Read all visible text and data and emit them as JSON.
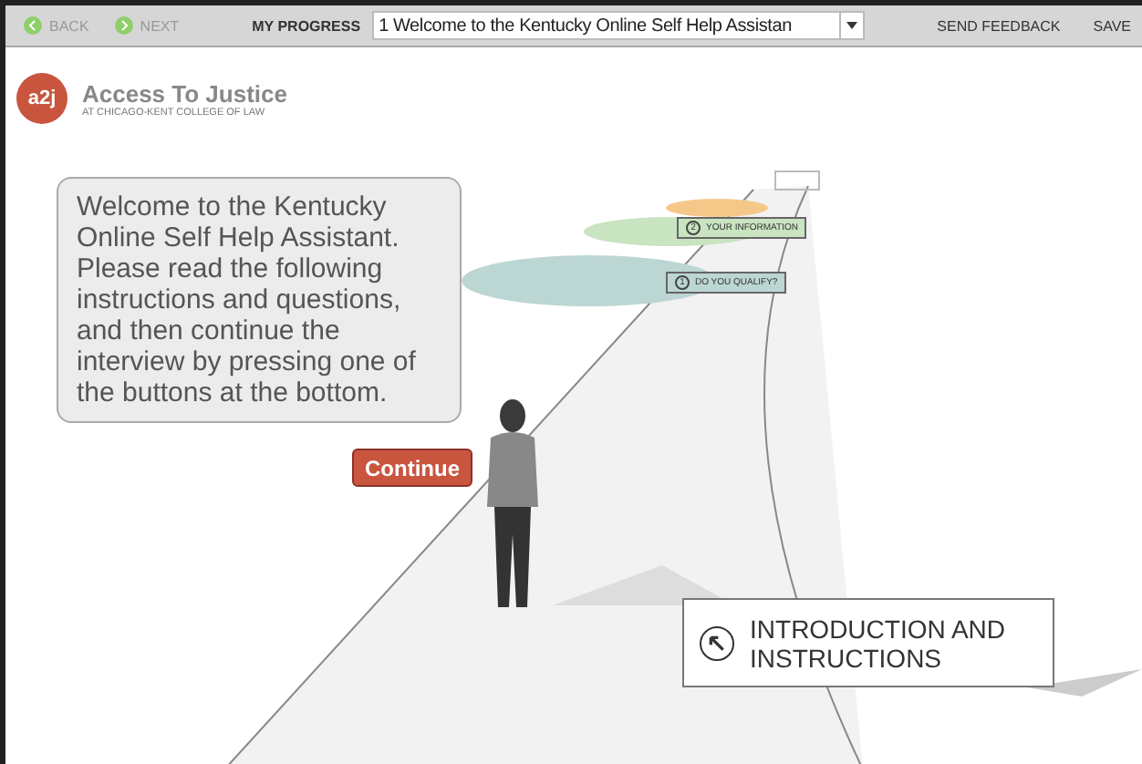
{
  "toolbar": {
    "back": "BACK",
    "next": "NEXT",
    "progress_label": "MY PROGRESS",
    "progress_value": "1 Welcome to the Kentucky Online Self Help Assistan",
    "send_feedback": "SEND FEEDBACK",
    "save": "SAVE"
  },
  "header": {
    "logo": "a2j",
    "title": "Access To Justice",
    "subtitle": "AT CHICAGO-KENT COLLEGE OF LAW"
  },
  "speech_bubble": {
    "text": "Welcome to the Kentucky Online Self Help Assistant. Please read the following instructions and questions, and then continue the interview by pressing one of the buttons at the bottom."
  },
  "continue_button": "Continue",
  "signs": [
    {
      "number": "2",
      "label": "YOUR INFORMATION",
      "color": "#c8e4c0"
    },
    {
      "number": "1",
      "label": "DO YOU QUALIFY?",
      "color": "#bcd6d3"
    }
  ],
  "main_sign": {
    "label": "INTRODUCTION AND INSTRUCTIONS"
  }
}
